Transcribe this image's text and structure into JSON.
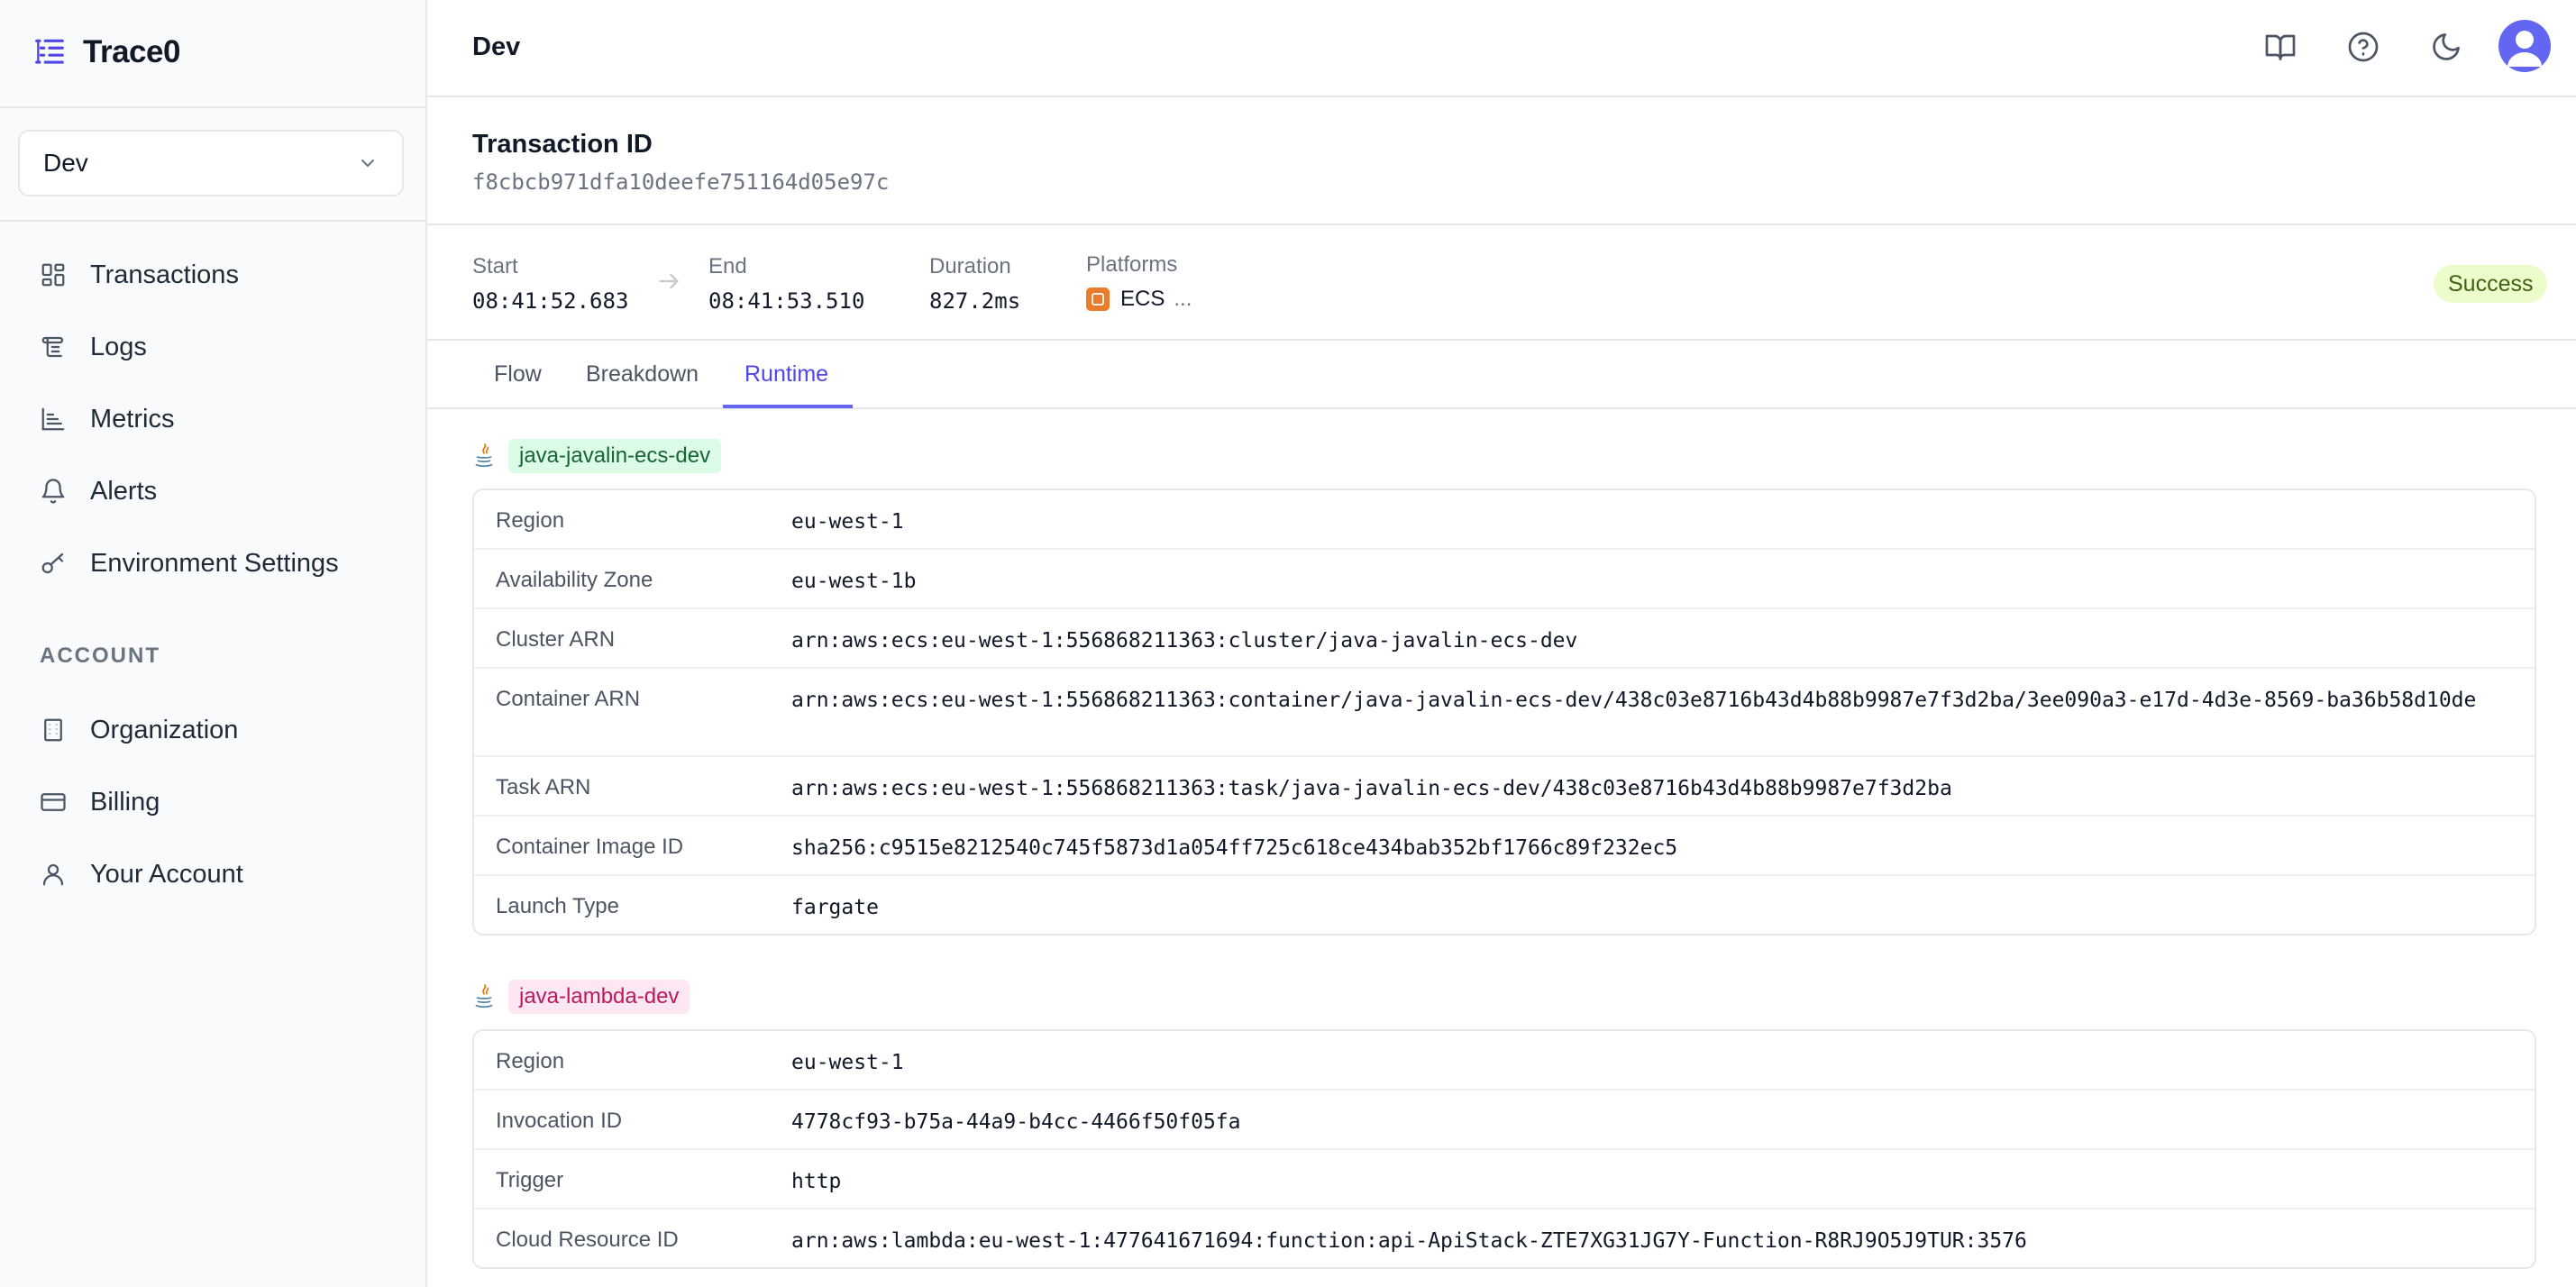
{
  "app": {
    "name": "Trace0"
  },
  "sidebar": {
    "environment": "Dev",
    "nav": [
      {
        "label": "Transactions",
        "icon": "dashboard-icon"
      },
      {
        "label": "Logs",
        "icon": "scroll-icon"
      },
      {
        "label": "Metrics",
        "icon": "bar-chart-icon"
      },
      {
        "label": "Alerts",
        "icon": "bell-icon"
      },
      {
        "label": "Environment Settings",
        "icon": "key-icon"
      }
    ],
    "account_section": "ACCOUNT",
    "account_nav": [
      {
        "label": "Organization",
        "icon": "building-icon"
      },
      {
        "label": "Billing",
        "icon": "credit-card-icon"
      },
      {
        "label": "Your Account",
        "icon": "user-icon"
      }
    ]
  },
  "header": {
    "title": "Dev",
    "icons": [
      "book-icon",
      "help-icon",
      "moon-icon",
      "avatar"
    ]
  },
  "transaction": {
    "label": "Transaction ID",
    "id": "f8cbcb971dfa10deefe751164d05e97c"
  },
  "timing": {
    "start_label": "Start",
    "start": "08:41:52.683",
    "end_label": "End",
    "end": "08:41:53.510",
    "duration_label": "Duration",
    "duration": "827.2ms",
    "platforms_label": "Platforms",
    "platform": "ECS",
    "platform_more": "...",
    "status": "Success"
  },
  "tabs": [
    {
      "label": "Flow",
      "active": false
    },
    {
      "label": "Breakdown",
      "active": false
    },
    {
      "label": "Runtime",
      "active": true
    }
  ],
  "runtime": [
    {
      "service": "java-javalin-ecs-dev",
      "rows": [
        {
          "key": "Region",
          "value": "eu-west-1"
        },
        {
          "key": "Availability Zone",
          "value": "eu-west-1b"
        },
        {
          "key": "Cluster ARN",
          "value": "arn:aws:ecs:eu-west-1:556868211363:cluster/java-javalin-ecs-dev"
        },
        {
          "key": "Container ARN",
          "value": "arn:aws:ecs:eu-west-1:556868211363:container/java-javalin-ecs-dev/438c03e8716b43d4b88b9987e7f3d2ba/3ee090a3-e17d-4d3e-8569-ba36b58d10de"
        },
        {
          "key": "Task ARN",
          "value": "arn:aws:ecs:eu-west-1:556868211363:task/java-javalin-ecs-dev/438c03e8716b43d4b88b9987e7f3d2ba"
        },
        {
          "key": "Container Image ID",
          "value": "sha256:c9515e8212540c745f5873d1a054ff725c618ce434bab352bf1766c89f232ec5"
        },
        {
          "key": "Launch Type",
          "value": "fargate"
        }
      ]
    },
    {
      "service": "java-lambda-dev",
      "rows": [
        {
          "key": "Region",
          "value": "eu-west-1"
        },
        {
          "key": "Invocation ID",
          "value": "4778cf93-b75a-44a9-b4cc-4466f50f05fa"
        },
        {
          "key": "Trigger",
          "value": "http"
        },
        {
          "key": "Cloud Resource ID",
          "value": "arn:aws:lambda:eu-west-1:477641671694:function:api-ApiStack-ZTE7XG31JG7Y-Function-R8RJ9O5J9TUR:3576"
        }
      ]
    }
  ],
  "colors": {
    "accent": "#6366f1",
    "success_bg": "#ecfccb",
    "success_text": "#3f6212",
    "tag_green_bg": "#dcfce7",
    "tag_pink_bg": "#fce7f3"
  }
}
